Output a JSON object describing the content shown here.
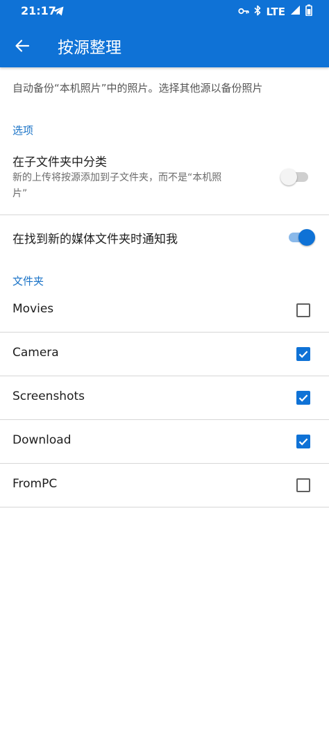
{
  "status_bar": {
    "time": "21:17",
    "network": "LTE",
    "icons": [
      "telegram-send-icon",
      "vpn-key-icon",
      "bluetooth-icon",
      "signal-icon",
      "battery-icon"
    ]
  },
  "app_bar": {
    "title": "按源整理",
    "color": "#0f72d6"
  },
  "description": "自动备份“本机照片”中的照片。选择其他源以备份照片",
  "options_section": {
    "title": "选项",
    "subfolder_pref": {
      "title": "在子文件夹中分类",
      "summary_line1": "新的上传将按源添加到子文件夹，而不是“本机照",
      "summary_line2": "片”",
      "enabled": false
    },
    "notify_pref": {
      "title": "在找到新的媒体文件夹时通知我",
      "enabled": true
    }
  },
  "folders_section": {
    "title": "文件夹",
    "folders": [
      {
        "label": "Movies",
        "checked": false
      },
      {
        "label": "Camera",
        "checked": true
      },
      {
        "label": "Screenshots",
        "checked": true
      },
      {
        "label": "Download",
        "checked": true
      },
      {
        "label": "FromPC",
        "checked": false
      }
    ]
  }
}
